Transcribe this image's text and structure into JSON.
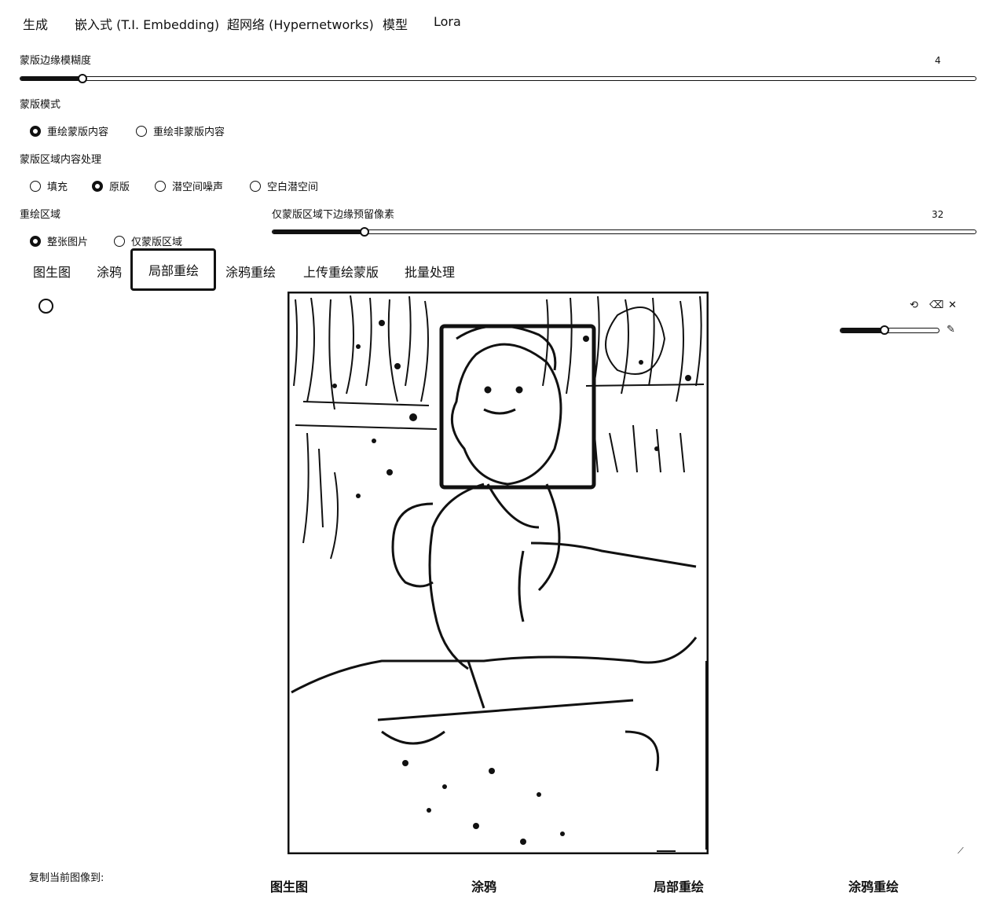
{
  "top_tabs": [
    "生成",
    "嵌入式 (T.I. Embedding)",
    "超网络 (Hypernetworks)",
    "模型",
    "Lora"
  ],
  "mask_blur": {
    "label": "蒙版边缘模糊度",
    "value": "4",
    "fraction": 0.066
  },
  "mask_mode": {
    "label": "蒙版模式",
    "options": [
      "重绘蒙版内容",
      "重绘非蒙版内容"
    ],
    "selected": "重绘蒙版内容"
  },
  "masked_content": {
    "label": "蒙版区域内容处理",
    "options": [
      "填充",
      "原版",
      "潜空间噪声",
      "空白潜空间"
    ],
    "selected": "原版"
  },
  "inpaint_area": {
    "label": "重绘区域",
    "options": [
      "整张图片",
      "仅蒙版区域"
    ],
    "selected": "整张图片"
  },
  "only_masked_padding": {
    "label": "仅蒙版区域下边缘预留像素",
    "value": "32",
    "fraction": 0.131
  },
  "sub_tabs": [
    "图生图",
    "涂鸦",
    "局部重绘",
    "涂鸦重绘",
    "上传重绘蒙版",
    "批量处理"
  ],
  "active_sub_tab": "局部重绘",
  "canvas_tools": {
    "icons": [
      "undo-icon",
      "erase-icon",
      "clear-icon",
      "brush-icon"
    ],
    "brush_size_fraction": 0.45
  },
  "copy_to": {
    "label": "复制当前图像到:",
    "buttons": [
      "图生图",
      "涂鸦",
      "局部重绘",
      "涂鸦重绘"
    ]
  }
}
